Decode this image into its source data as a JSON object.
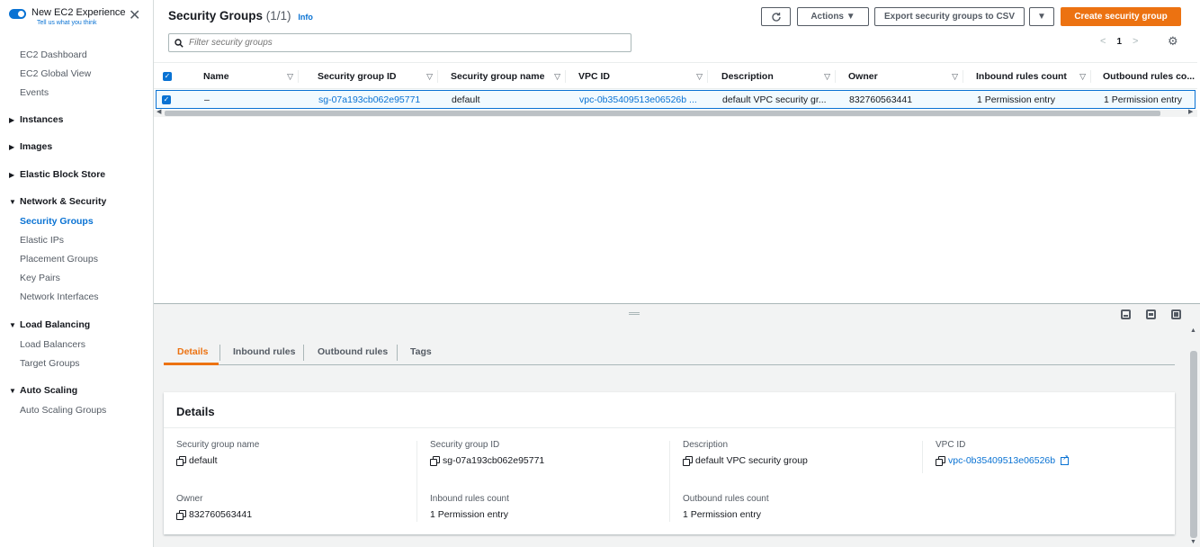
{
  "sidebar": {
    "new_experience_title": "New EC2 Experience",
    "new_experience_sub": "Tell us what you think",
    "links": [
      "EC2 Dashboard",
      "EC2 Global View",
      "Events"
    ],
    "categories": {
      "instances": "Instances",
      "images": "Images",
      "ebs": "Elastic Block Store",
      "network": "Network & Security",
      "load_balancing": "Load Balancing",
      "auto_scaling": "Auto Scaling"
    },
    "network_items": [
      "Security Groups",
      "Elastic IPs",
      "Placement Groups",
      "Key Pairs",
      "Network Interfaces"
    ],
    "lb_items": [
      "Load Balancers",
      "Target Groups"
    ],
    "as_items": [
      "Auto Scaling Groups"
    ]
  },
  "header": {
    "title": "Security Groups",
    "count": "(1/1)",
    "info": "Info",
    "actions": "Actions ▼",
    "export": "Export security groups to CSV",
    "export_more": "▼",
    "create": "Create security group",
    "search_placeholder": "Filter security groups",
    "page": "1"
  },
  "table": {
    "columns": [
      "Name",
      "Security group ID",
      "Security group name",
      "VPC ID",
      "Description",
      "Owner",
      "Inbound rules count",
      "Outbound rules co..."
    ],
    "rows": [
      [
        "–",
        "sg-07a193cb062e95771",
        "default",
        "vpc-0b35409513e06526b ...",
        "default VPC security gr...",
        "832760563441",
        "1 Permission entry",
        "1 Permission entry"
      ]
    ]
  },
  "details": {
    "tabs": [
      "Details",
      "Inbound rules",
      "Outbound rules",
      "Tags"
    ],
    "card_title": "Details",
    "fields": {
      "sg_name_label": "Security group name",
      "sg_name": "default",
      "sg_id_label": "Security group ID",
      "sg_id": "sg-07a193cb062e95771",
      "desc_label": "Description",
      "desc": "default VPC security group",
      "vpc_label": "VPC ID",
      "vpc": "vpc-0b35409513e06526b",
      "owner_label": "Owner",
      "owner": "832760563441",
      "inbound_label": "Inbound rules count",
      "inbound": "1 Permission entry",
      "outbound_label": "Outbound rules count",
      "outbound": "1 Permission entry"
    }
  },
  "colors": {
    "link": "#0972d3",
    "primary": "#ec7211",
    "text": "#16191f"
  }
}
